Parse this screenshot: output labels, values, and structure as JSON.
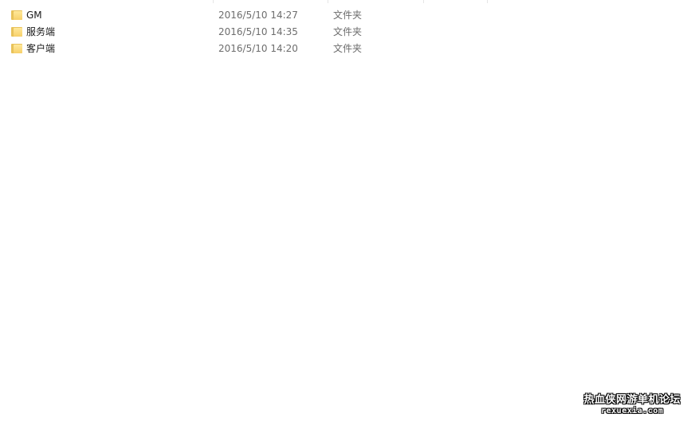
{
  "files": [
    {
      "name": "GM",
      "modified": "2016/5/10 14:27",
      "type": "文件夹",
      "icon": "folder-icon"
    },
    {
      "name": "服务端",
      "modified": "2016/5/10 14:35",
      "type": "文件夹",
      "icon": "folder-icon"
    },
    {
      "name": "客户端",
      "modified": "2016/5/10 14:20",
      "type": "文件夹",
      "icon": "folder-icon"
    }
  ],
  "watermark": {
    "text": "热血侠网游单机论坛",
    "url": "rexuexia.com"
  },
  "colors": {
    "folder_back": "#e8c25a",
    "folder_front": "#ffe89a",
    "meta_text": "#6d6d6d"
  }
}
